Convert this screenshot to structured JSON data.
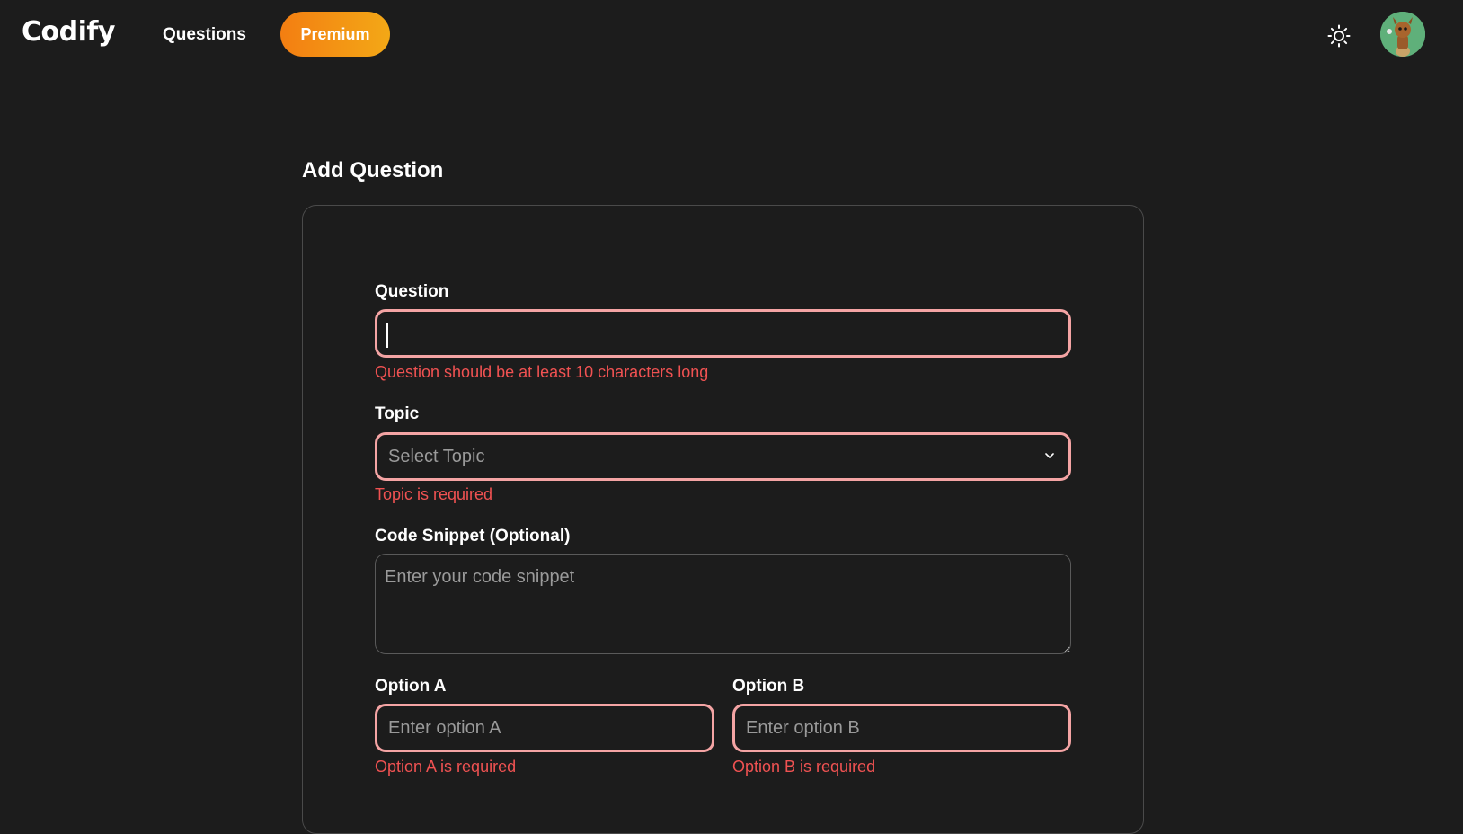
{
  "navbar": {
    "brand": "Codify",
    "questions_link": "Questions",
    "premium_button": "Premium",
    "theme_icon": "sun-icon",
    "avatar_icon": "user-avatar",
    "premium_gradient": [
      "#f37e12",
      "#f3a816"
    ]
  },
  "page": {
    "title": "Add Question"
  },
  "form": {
    "question": {
      "label": "Question",
      "value": "",
      "error": "Question should be at least 10 characters long"
    },
    "topic": {
      "label": "Topic",
      "selected": "Select Topic",
      "error": "Topic is required"
    },
    "code_snippet": {
      "label": "Code Snippet (Optional)",
      "placeholder": "Enter your code snippet"
    },
    "option_a": {
      "label": "Option A",
      "placeholder": "Enter option A",
      "error": "Option A is required"
    },
    "option_b": {
      "label": "Option B",
      "placeholder": "Enter option B",
      "error": "Option B is required"
    }
  },
  "colors": {
    "background": "#1c1c1c",
    "error": "#f05252",
    "error_border": "#f4a4a4"
  }
}
